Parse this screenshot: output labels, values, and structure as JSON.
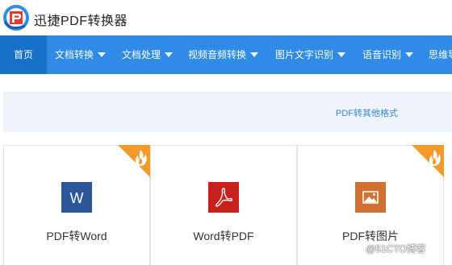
{
  "header": {
    "brand": "迅捷PDF转换器"
  },
  "nav": {
    "items": [
      {
        "label": "首页"
      },
      {
        "label": "文档转换"
      },
      {
        "label": "文档处理"
      },
      {
        "label": "视频音频转换"
      },
      {
        "label": "图片文字识别"
      },
      {
        "label": "语音识别"
      },
      {
        "label": "思维导"
      }
    ]
  },
  "subbar": {
    "tab": "PDF转其他格式"
  },
  "cards": [
    {
      "title": "PDF转Word",
      "icon": "word-icon",
      "hot": true
    },
    {
      "title": "Word转PDF",
      "icon": "pdf-icon",
      "hot": false
    },
    {
      "title": "PDF转图片",
      "icon": "image-icon",
      "hot": true
    }
  ],
  "watermark": "@51CTO博客",
  "colors": {
    "nav_bg": "#2f8be5",
    "nav_active": "#1671c9",
    "hot_ribbon": "#f39a2b",
    "word": "#2b579a",
    "pdf": "#c8201c",
    "image": "#cf7231"
  }
}
